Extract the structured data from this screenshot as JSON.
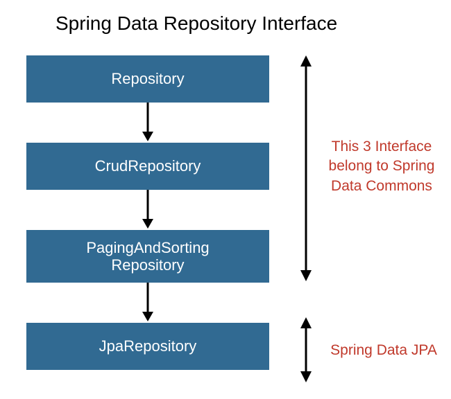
{
  "title": "Spring Data Repository Interface",
  "boxes": [
    {
      "label": "Repository"
    },
    {
      "label": "CrudRepository"
    },
    {
      "label": "PagingAndSorting Repository",
      "tall": true
    },
    {
      "label": "JpaRepository"
    }
  ],
  "annotations": {
    "top": "This 3 Interface belong to Spring Data Commons",
    "bottom": "Spring Data JPA"
  },
  "colors": {
    "box_bg": "#316a92",
    "box_text": "#ffffff",
    "annotation_text": "#c0392b"
  }
}
